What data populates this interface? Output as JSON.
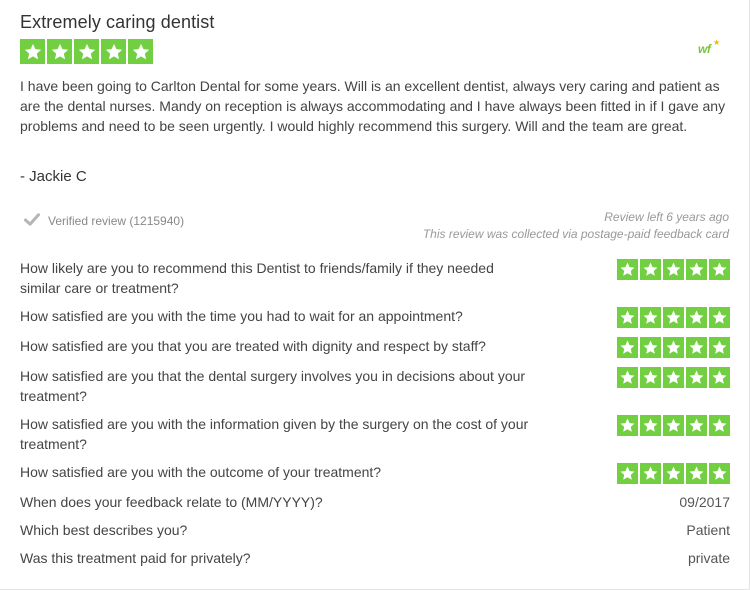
{
  "review": {
    "title": "Extremely caring dentist",
    "rating_stars": 5,
    "logo_text": "wf",
    "body": "I have been going to Carlton Dental for some years. Will is an excellent dentist, always very caring and patient as are the dental nurses. Mandy on reception is always accommodating and I have always been fitted in if I gave any problems and need to be seen urgently. I would highly recommend this surgery. Will and the team are great.",
    "author": "- Jackie C",
    "verified_label": "Verified review (1215940)",
    "left_ago": "Review left 6 years ago",
    "collected_via": "This review was collected via postage-paid feedback card"
  },
  "questions": [
    {
      "question": "How likely are you to recommend this Dentist to friends/family if they needed similar care or treatment?",
      "stars": 5
    },
    {
      "question": "How satisfied are you with the time you had to wait for an appointment?",
      "stars": 5
    },
    {
      "question": "How satisfied are you that you are treated with dignity and respect by staff?",
      "stars": 5
    },
    {
      "question": "How satisfied are you that the dental surgery involves you in decisions about your treatment?",
      "stars": 5
    },
    {
      "question": "How satisfied are you with the information given by the surgery on the cost of your treatment?",
      "stars": 5
    },
    {
      "question": "How satisfied are you with the outcome of your treatment?",
      "stars": 5
    },
    {
      "question": "When does your feedback relate to (MM/YYYY)?",
      "answer": "09/2017"
    },
    {
      "question": "Which best describes you?",
      "answer": "Patient"
    },
    {
      "question": "Was this treatment paid for privately?",
      "answer": "private"
    }
  ],
  "colors": {
    "star_green": "#73cf42",
    "logo_green": "#7cc242"
  },
  "icons": {
    "star": "star-icon",
    "check": "check-icon"
  }
}
